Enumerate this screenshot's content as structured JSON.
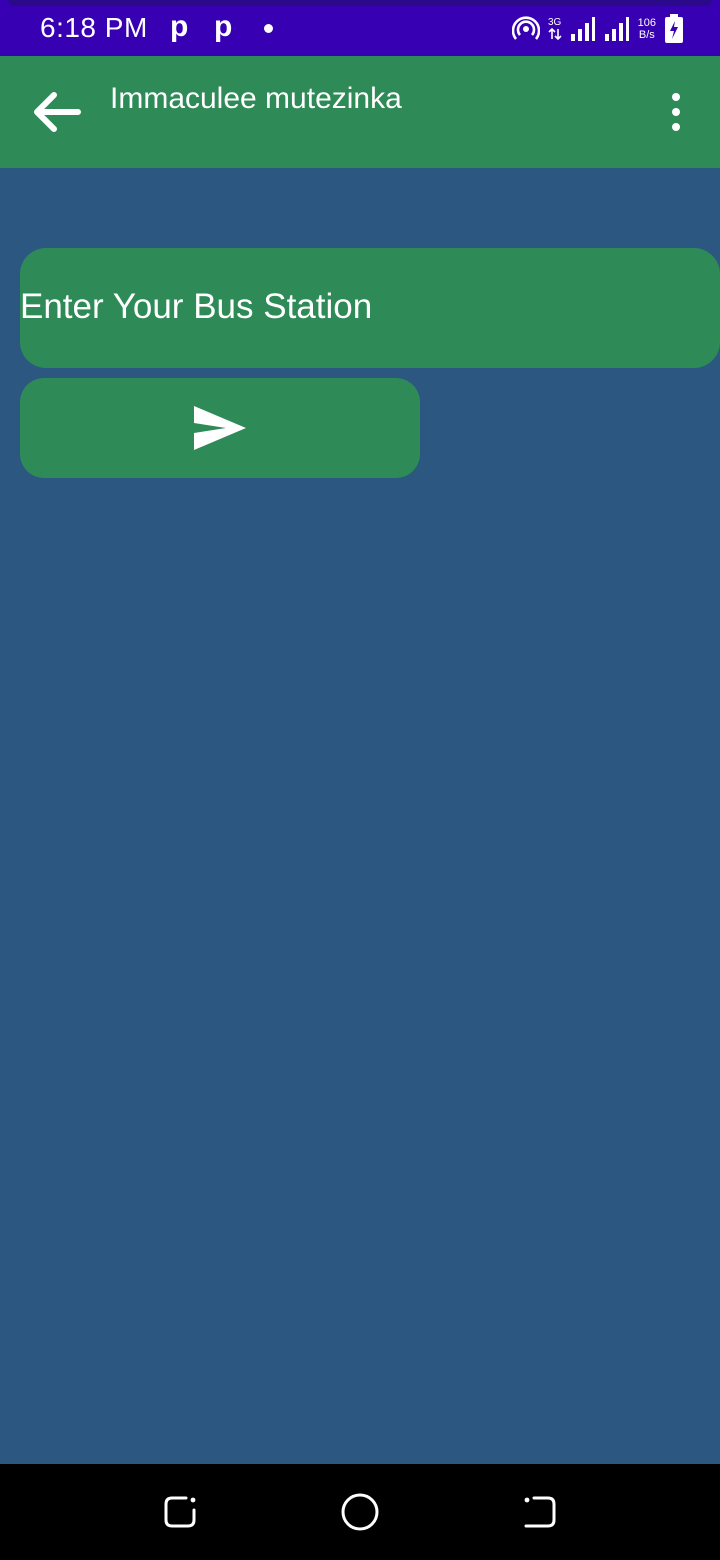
{
  "status_bar": {
    "time": "6:18 PM",
    "notif_icons": [
      "p",
      "p"
    ],
    "network_type": "3G",
    "speed_value": "106",
    "speed_unit": "B/s",
    "background": "#3700b3"
  },
  "app_bar": {
    "title": "Immaculee mutezinka",
    "background": "#2e8b57",
    "back_icon": "arrow-left-icon",
    "menu_icon": "more-vert-icon"
  },
  "main": {
    "background": "#2c5780",
    "station_field": {
      "value": "Enter Your Bus Station"
    },
    "send_button": {
      "icon": "send-icon"
    }
  },
  "nav_bar": {
    "items": [
      "recent-apps-icon",
      "home-icon",
      "back-nav-icon"
    ]
  }
}
